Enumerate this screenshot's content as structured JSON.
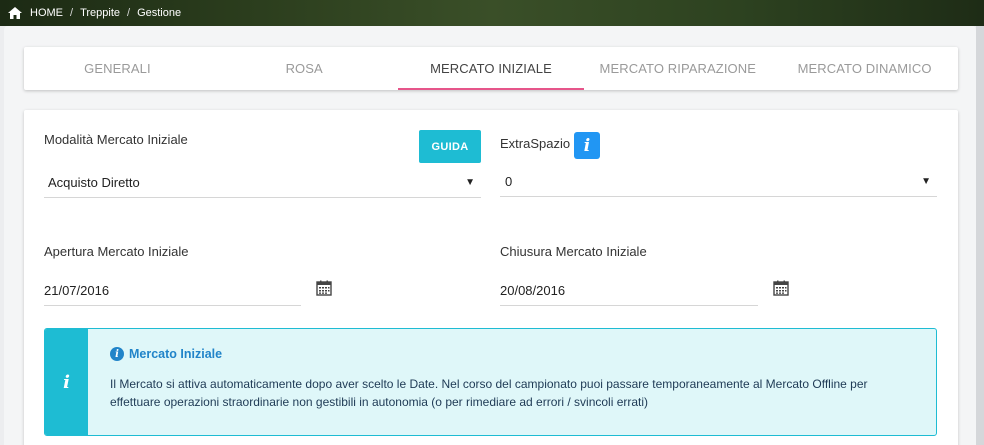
{
  "breadcrumb": {
    "home": "HOME",
    "items": [
      "Treppite",
      "Gestione"
    ],
    "separator": "/"
  },
  "tabs": [
    {
      "label": "GENERALI",
      "active": false
    },
    {
      "label": "ROSA",
      "active": false
    },
    {
      "label": "MERCATO INIZIALE",
      "active": true
    },
    {
      "label": "MERCATO RIPARAZIONE",
      "active": false
    },
    {
      "label": "MERCATO DINAMICO",
      "active": false
    }
  ],
  "form": {
    "modalita_label": "Modalità Mercato Iniziale",
    "modalita_value": "Acquisto Diretto",
    "guida_label": "GUIDA",
    "extraspazio_label": "ExtraSpazio",
    "extraspazio_value": "0",
    "info_glyph": "i",
    "apertura_label": "Apertura Mercato Iniziale",
    "apertura_value": "21/07/2016",
    "chiusura_label": "Chiusura Mercato Iniziale",
    "chiusura_value": "20/08/2016",
    "caret": "▼"
  },
  "alert": {
    "side_glyph": "i",
    "title_glyph": "i",
    "title": "Mercato Iniziale",
    "body": "Il Mercato si attiva automaticamente dopo aver scelto le Date. Nel corso del campionato puoi passare temporaneamente al Mercato Offline per effettuare operazioni straordinarie non gestibili in autonomia (o per rimediare ad errori / svincoli errati)"
  },
  "colors": {
    "accent_tab": "#e6558a",
    "guida_button": "#1ebcd3",
    "info_button": "#2196f3",
    "alert_bg": "#dff7f9",
    "alert_title": "#2184c9"
  },
  "icons": [
    "home-icon",
    "info-icon",
    "calendar-icon"
  ]
}
